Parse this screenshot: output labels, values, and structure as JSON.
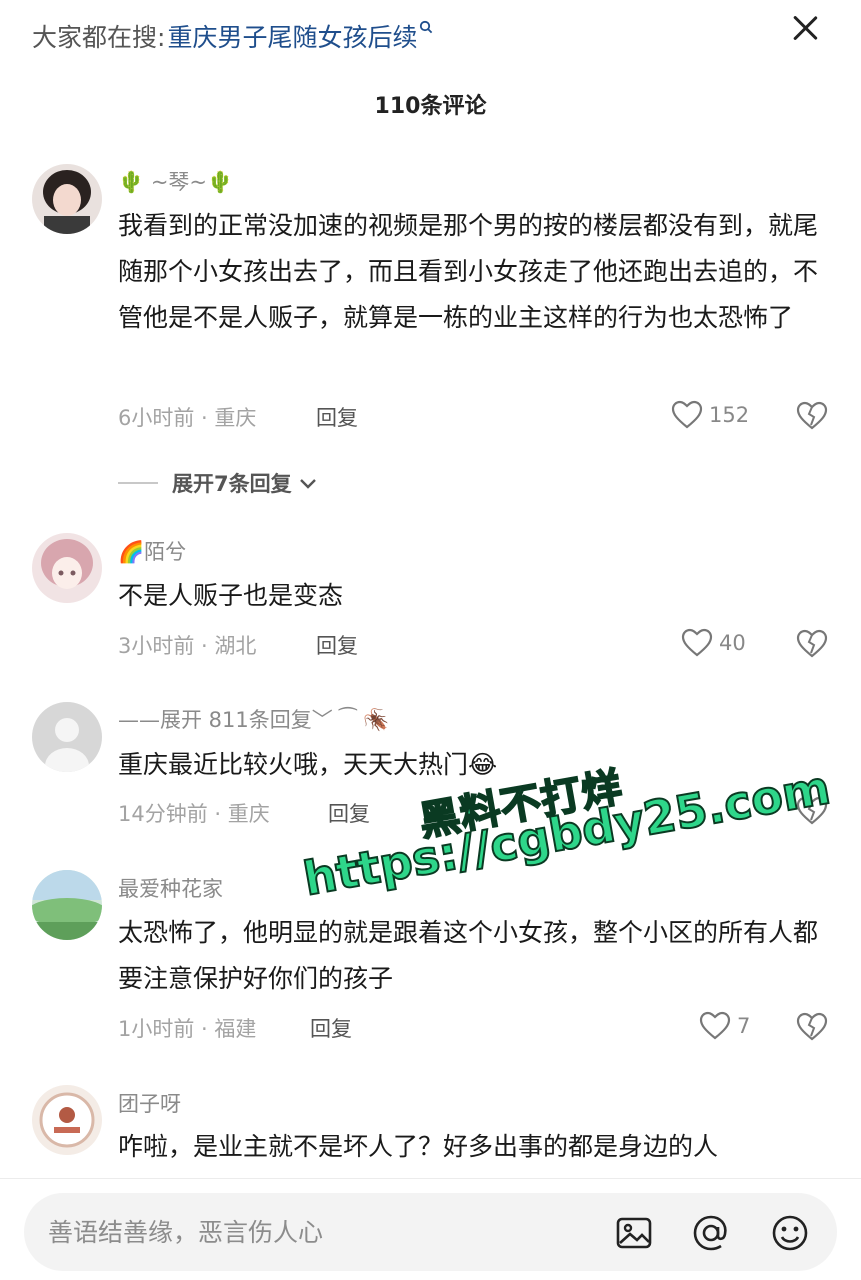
{
  "search": {
    "prefix": "大家都在搜:",
    "term": "重庆男子尾随女孩后续",
    "mini_icon": "search-icon-mini"
  },
  "header": {
    "count_title": "110条评论"
  },
  "comments": [
    {
      "username": "🌵 ~琴~🌵",
      "text": "我看到的正常没加速的视频是那个男的按的楼层都没有到，就尾随那个小女孩出去了，而且看到小女孩走了他还跑出去追的，不管他是不是人贩子，就算是一栋的业主这样的行为也太恐怖了",
      "meta": "6小时前 · 重庆",
      "reply": "回复",
      "likes": "152"
    },
    {
      "username": "🌈陌兮",
      "text": "不是人贩子也是变态",
      "meta": "3小时前 · 湖北",
      "reply": "回复",
      "likes": "40"
    },
    {
      "username": "——展开 811条回复﹀ ⁀ 🪳",
      "text": "重庆最近比较火哦，天天大热门😂",
      "meta": "14分钟前 · 重庆",
      "reply": "回复",
      "likes": ""
    },
    {
      "username": "最爱种花家",
      "text": "太恐怖了，他明显的就是跟着这个小女孩，整个小区的所有人都要注意保护好你们的孩子",
      "meta": "1小时前 · 福建",
      "reply": "回复",
      "likes": "7"
    },
    {
      "username": "团子呀",
      "text": "咋啦，是业主就不是坏人了？好多出事的都是身边的人",
      "meta": "",
      "reply": "",
      "likes": ""
    }
  ],
  "expand": {
    "label": "展开7条回复"
  },
  "watermark": {
    "line1": "黑料不打烊",
    "line2": "https://cgbdy25.com"
  },
  "input": {
    "placeholder": "善语结善缘，恶言伤人心"
  },
  "icons": [
    "close-icon",
    "heart-icon",
    "broken-heart-icon",
    "chevron-down-icon",
    "image-icon",
    "at-icon",
    "emoji-icon"
  ],
  "colors": {
    "link": "#1f4e8c",
    "muted": "#8a8a8a",
    "watermark": "#2ed68a"
  }
}
